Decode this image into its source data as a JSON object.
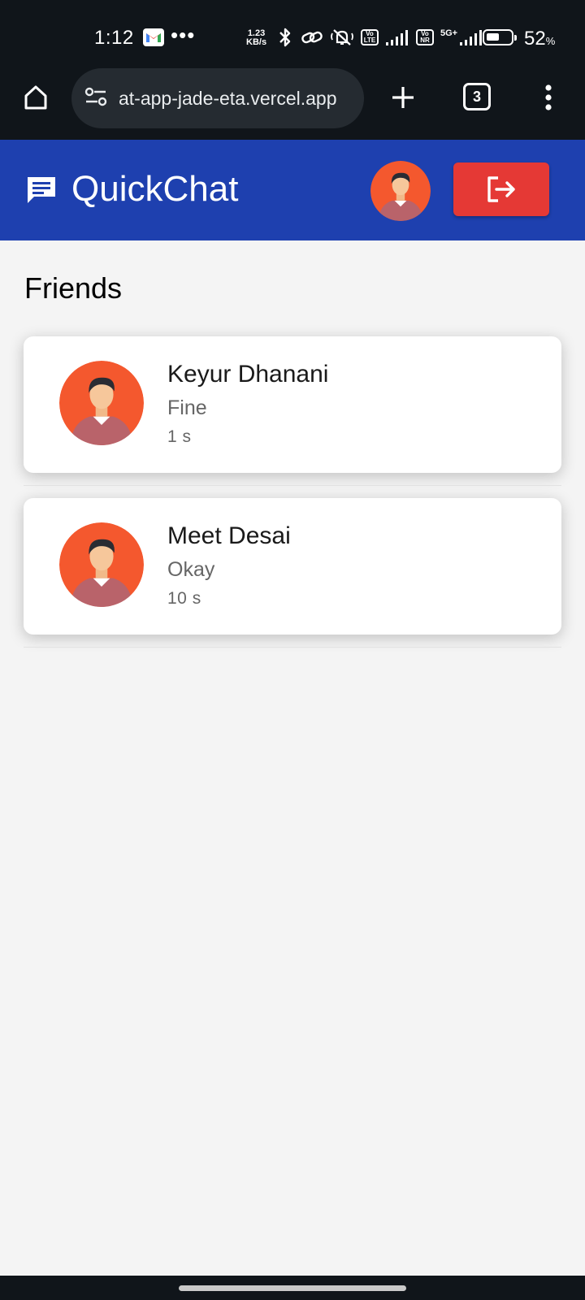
{
  "status_bar": {
    "time": "1:12",
    "net_speed_value": "1.23",
    "net_speed_unit": "KB/s",
    "vo_lte_top": "Vo",
    "vo_lte_bottom": "LTE",
    "vo_nr_top": "Vo",
    "vo_nr_bottom": "NR",
    "network_5g": "5G+",
    "battery_percent": "52",
    "battery_percent_sign": "%",
    "battery_level": 0.52,
    "more_dots": "•••"
  },
  "browser": {
    "url": "at-app-jade-eta.vercel.app",
    "tab_count": "3"
  },
  "app": {
    "title": "QuickChat",
    "header_color": "#1e40af",
    "logout_color": "#e53935"
  },
  "friends": {
    "heading": "Friends",
    "items": [
      {
        "name": "Keyur Dhanani",
        "last_message": "Fine",
        "time_ago": "1 s"
      },
      {
        "name": "Meet Desai",
        "last_message": "Okay",
        "time_ago": "10 s"
      }
    ]
  },
  "icons": {
    "home": "home-icon",
    "site_settings": "tune-icon",
    "new_tab": "plus-icon",
    "tabs": "tab-switcher-icon",
    "menu": "more-vert-icon",
    "chat": "chat-bubble-icon",
    "logout": "logout-icon",
    "avatar": "user-avatar-icon"
  }
}
